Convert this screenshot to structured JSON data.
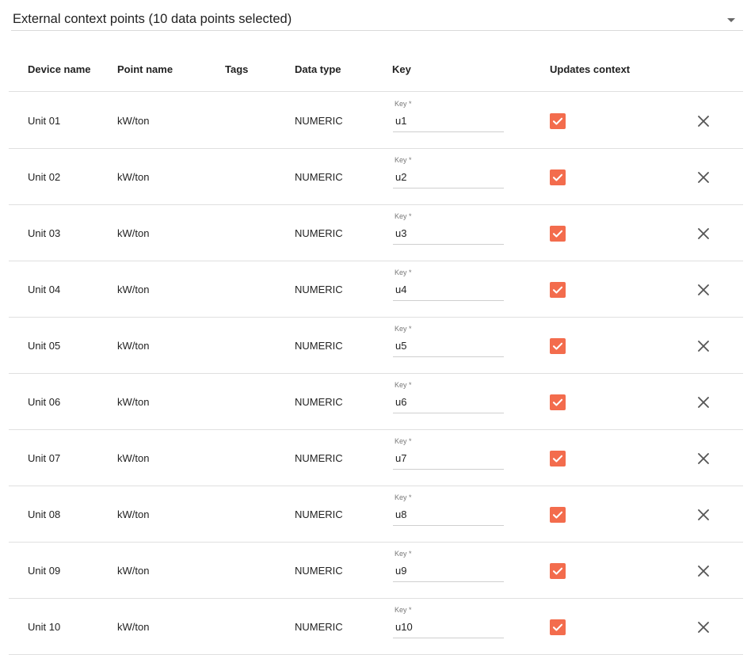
{
  "selector": {
    "label": "External context points (10 data points selected)",
    "caret_icon": "arrow-drop-down-icon"
  },
  "table": {
    "headers": {
      "device_name": "Device name",
      "point_name": "Point name",
      "tags": "Tags",
      "data_type": "Data type",
      "key": "Key",
      "updates_context": "Updates context"
    },
    "key_field_label": "Key *",
    "accent_color": "#f36c4d",
    "rows": [
      {
        "device_name": "Unit 01",
        "point_name": "kW/ton",
        "tags": "",
        "data_type": "NUMERIC",
        "key": "u1",
        "updates_context": true
      },
      {
        "device_name": "Unit 02",
        "point_name": "kW/ton",
        "tags": "",
        "data_type": "NUMERIC",
        "key": "u2",
        "updates_context": true
      },
      {
        "device_name": "Unit 03",
        "point_name": "kW/ton",
        "tags": "",
        "data_type": "NUMERIC",
        "key": "u3",
        "updates_context": true
      },
      {
        "device_name": "Unit 04",
        "point_name": "kW/ton",
        "tags": "",
        "data_type": "NUMERIC",
        "key": "u4",
        "updates_context": true
      },
      {
        "device_name": "Unit 05",
        "point_name": "kW/ton",
        "tags": "",
        "data_type": "NUMERIC",
        "key": "u5",
        "updates_context": true
      },
      {
        "device_name": "Unit 06",
        "point_name": "kW/ton",
        "tags": "",
        "data_type": "NUMERIC",
        "key": "u6",
        "updates_context": true
      },
      {
        "device_name": "Unit 07",
        "point_name": "kW/ton",
        "tags": "",
        "data_type": "NUMERIC",
        "key": "u7",
        "updates_context": true
      },
      {
        "device_name": "Unit 08",
        "point_name": "kW/ton",
        "tags": "",
        "data_type": "NUMERIC",
        "key": "u8",
        "updates_context": true
      },
      {
        "device_name": "Unit 09",
        "point_name": "kW/ton",
        "tags": "",
        "data_type": "NUMERIC",
        "key": "u9",
        "updates_context": true
      },
      {
        "device_name": "Unit 10",
        "point_name": "kW/ton",
        "tags": "",
        "data_type": "NUMERIC",
        "key": "u10",
        "updates_context": true
      }
    ]
  }
}
